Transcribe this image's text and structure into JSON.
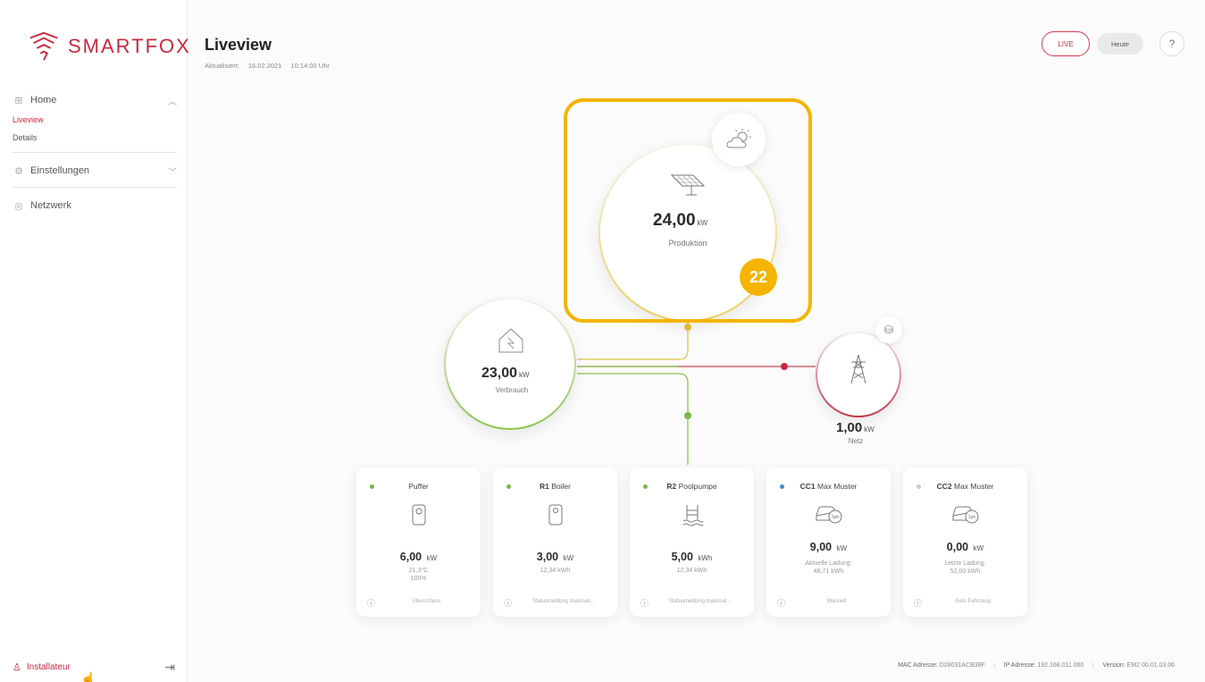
{
  "app": {
    "brand": "SMARTFOX"
  },
  "sidebar": {
    "home_label": "Home",
    "home_sub": [
      "Liveview",
      "Details"
    ],
    "settings_label": "Einstellungen",
    "network_label": "Netzwerk",
    "user_label": "Installateur"
  },
  "header": {
    "title": "Liveview",
    "updated_label": "Aktualisiert:",
    "updated_date": "16.02.2021",
    "updated_time": "10:14:00 Uhr",
    "live_label": "LIVE",
    "today_label": "Heute",
    "help_label": "?"
  },
  "flow": {
    "production": {
      "value": "24,00",
      "unit": "kW",
      "label": "Produktion"
    },
    "consumption": {
      "value": "23,00",
      "unit": "kW",
      "label": "Verbrauch"
    },
    "grid": {
      "value": "1,00",
      "unit": "kW",
      "label": "Netz"
    },
    "step_number": "22"
  },
  "devices": [
    {
      "code": "",
      "name": "Puffer",
      "value": "6,00",
      "unit": "kW",
      "sub1": "21,3°C",
      "sub2": "100%",
      "footer": "Überschuss",
      "dot_color": "#7ab648",
      "icon": "boiler-icon"
    },
    {
      "code": "R1",
      "name": "Boiler",
      "value": "3,00",
      "unit": "kW",
      "sub1": "12,34 kWh",
      "sub2": "",
      "footer": "Statusmeldung maximal...",
      "dot_color": "#7ab648",
      "icon": "boiler-icon"
    },
    {
      "code": "R2",
      "name": "Poolpumpe",
      "value": "5,00",
      "unit": "kWh",
      "sub1": "12,34 kWh",
      "sub2": "",
      "footer": "Statusmeldung maximal...",
      "dot_color": "#7ab648",
      "icon": "pool-icon"
    },
    {
      "code": "CC1",
      "name": "Max Muster",
      "value": "9,00",
      "unit": "kW",
      "sub1": "Aktuelle Ladung:",
      "sub2": "48,71 kWh",
      "footer": "Manuell",
      "dot_color": "#3d8fd6",
      "icon": "car-charging-icon"
    },
    {
      "code": "CC2",
      "name": "Max Muster",
      "value": "0,00",
      "unit": "kW",
      "sub1": "Letzte Ladung:",
      "sub2": "52,00 kWh",
      "footer": "Kein Fahrzeug",
      "dot_color": "#cccccc",
      "icon": "car-charging-icon"
    }
  ],
  "footer": {
    "mac_label": "MAC Adresse:",
    "mac_value": "D28031ACB38F",
    "ip_label": "IP Adresse:",
    "ip_value": "192.168.011.060",
    "version_label": "Version:",
    "version_value": "EM2 00.01.03.06"
  },
  "colors": {
    "accent": "#c9283e",
    "production": "#e7d05a",
    "consumption": "#8cc24c",
    "grid": "#c23a4a",
    "highlight": "#f4b400"
  }
}
